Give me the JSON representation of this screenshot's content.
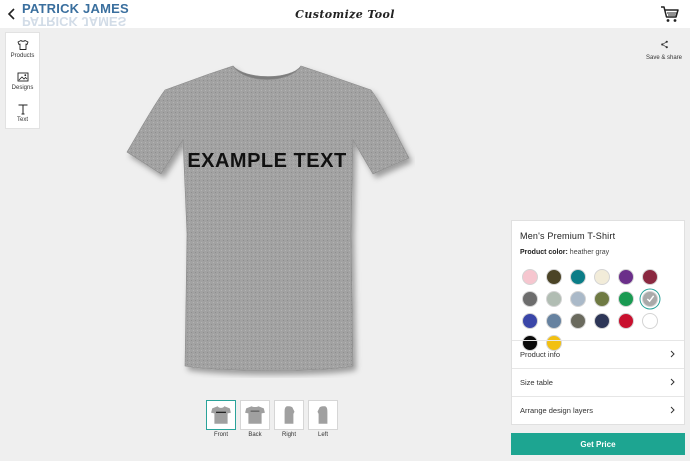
{
  "header": {
    "brand": "PATRICK JAMES",
    "title": "Customize Tool"
  },
  "toolbar": {
    "items": [
      {
        "label": "Products",
        "icon": "tshirt-icon"
      },
      {
        "label": "Designs",
        "icon": "image-icon"
      },
      {
        "label": "Text",
        "icon": "text-icon"
      }
    ]
  },
  "share": {
    "label": "Save & share",
    "icon": "share-icon"
  },
  "design": {
    "text": "EXAMPLE TEXT",
    "shirt_color": "#9e9e9e"
  },
  "views": [
    {
      "label": "Front",
      "active": true
    },
    {
      "label": "Back",
      "active": false
    },
    {
      "label": "Right",
      "active": false
    },
    {
      "label": "Left",
      "active": false
    }
  ],
  "panel": {
    "product_name": "Men's Premium T-Shirt",
    "color_label": "Product color:",
    "color_value": "heather gray",
    "swatches": [
      "#f6c6cf",
      "#4b4426",
      "#0b7d87",
      "#f2ecd9",
      "#6b2f8a",
      "#8a2840",
      "#6d6d6d",
      "#b1bdb3",
      "#aab9c8",
      "#6f7a43",
      "#1a9a52",
      "#a9a9a9",
      "#3a46a8",
      "#6682a0",
      "#6a6a5e",
      "#2d3657",
      "#c8102e",
      "#ffffff",
      "#0a0a0a",
      "#f2c012"
    ],
    "selected_index": 11,
    "rows": [
      "Product info",
      "Size table",
      "Arrange design layers"
    ]
  },
  "price_button": "Get Price",
  "colors": {
    "accent": "#1da591",
    "brand": "#3a6f9e"
  }
}
